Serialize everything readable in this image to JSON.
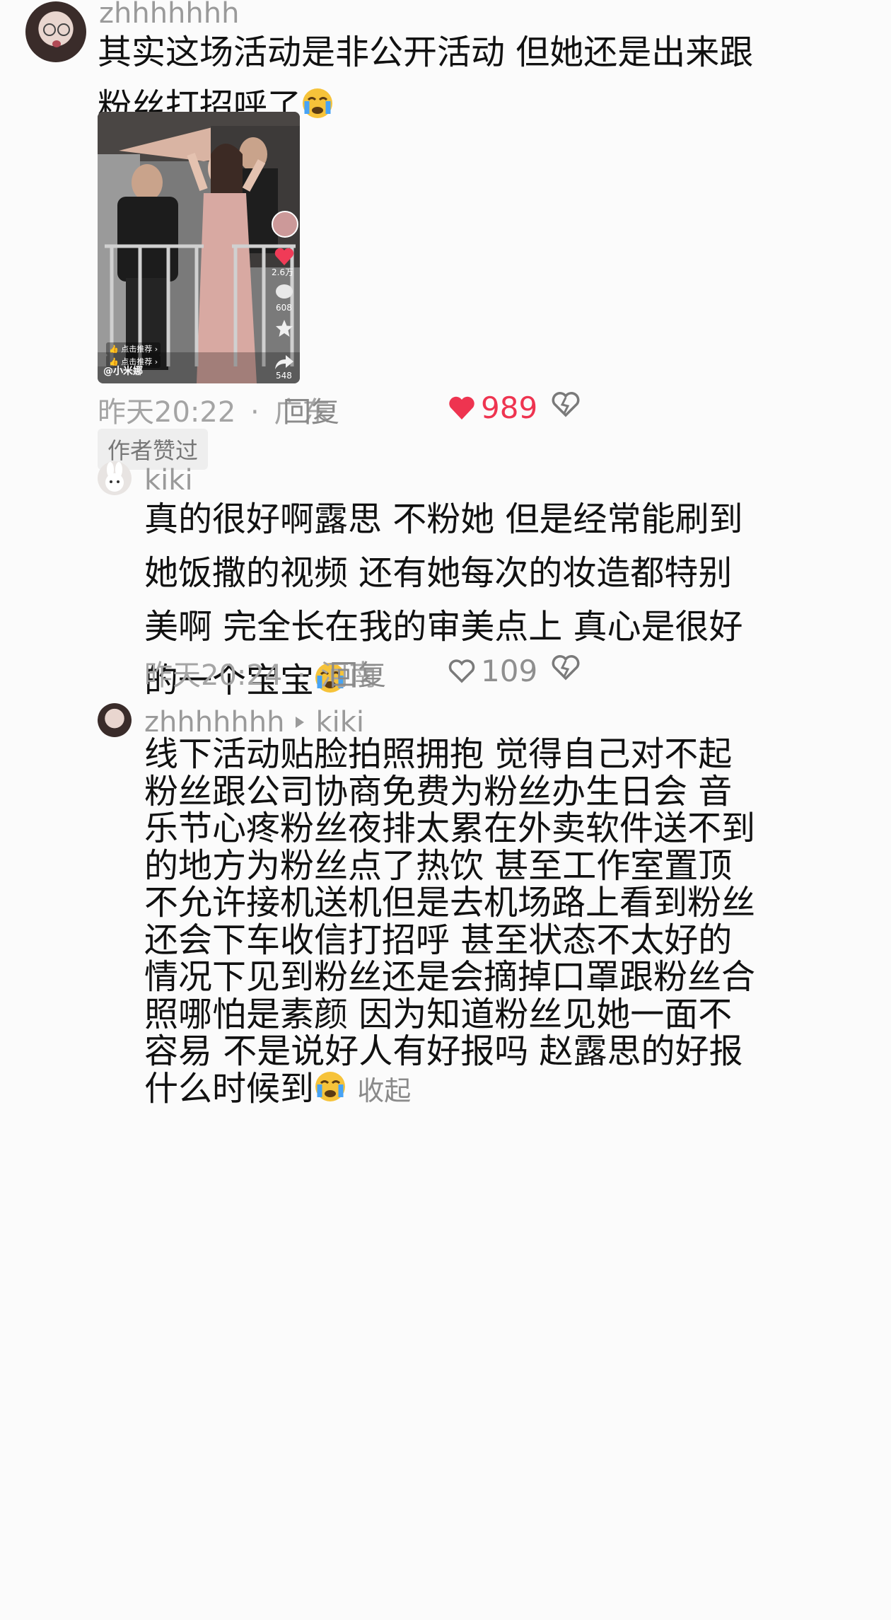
{
  "comments": [
    {
      "username": "zhhhhhhh",
      "text_line1": "其实这场活动是非公开活动 但她还是出来跟",
      "text_line2": "粉丝打招呼了",
      "emoji": "crying-face-emoji",
      "time": "昨天20:22",
      "separator": "·",
      "location": "广东",
      "reply_label": "回复",
      "likes": "989",
      "liked": true,
      "badge": "作者赞过",
      "video": {
        "likes": "2.6万",
        "comments": "608",
        "shares": "548",
        "recommend1": "点击推荐",
        "recommend2": "点击推荐",
        "handle": "@小米娜"
      }
    },
    {
      "username": "kiki",
      "lines": [
        "真的很好啊露思 不粉她 但是经常能刷到",
        "她饭撒的视频 还有她每次的妆造都特别",
        "美啊 完全长在我的审美点上 真心是很好",
        "的一个宝宝"
      ],
      "time": "昨天20:24",
      "separator": "·",
      "location": "河南",
      "reply_label": "回复",
      "likes": "109"
    },
    {
      "username": "zhhhhhhh",
      "reply_to": "kiki",
      "lines": [
        "线下活动贴脸拍照拥抱 觉得自己对不起",
        "粉丝跟公司协商免费为粉丝办生日会 音",
        "乐节心疼粉丝夜排太累在外卖软件送不到",
        "的地方为粉丝点了热饮 甚至工作室置顶",
        "不允许接机送机但是去机场路上看到粉丝",
        "还会下车收信打招呼 甚至状态不太好的",
        "情况下见到粉丝还是会摘掉口罩跟粉丝合",
        "照哪怕是素颜 因为知道粉丝见她一面不",
        "容易 不是说好人有好报吗 赵露思的好报",
        "什么时候到"
      ],
      "collapse_label": "收起"
    }
  ],
  "colors": {
    "heart_red": "#ee3450",
    "meta_gray": "#a4a4a4"
  }
}
